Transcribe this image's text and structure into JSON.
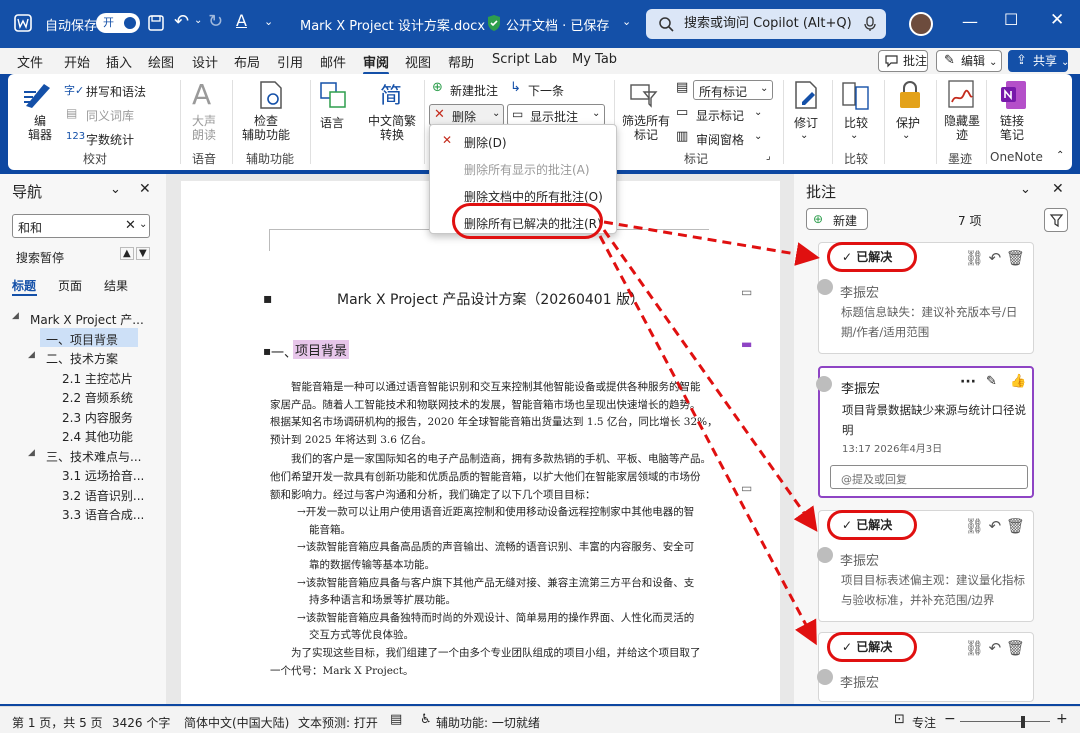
{
  "titlebar": {
    "autosave_label": "自动保存",
    "autosave_state": "开",
    "document_title": "Mark X Project 设计方案.docx",
    "sensitivity": "公开文档 · 已保存",
    "search_placeholder": "搜索或询问 Copilot (Alt+Q)"
  },
  "menu": {
    "tabs": [
      "文件",
      "开始",
      "插入",
      "绘图",
      "设计",
      "布局",
      "引用",
      "邮件",
      "审阅",
      "视图",
      "帮助",
      "Script Lab",
      "My Tab"
    ],
    "active_tab": "审阅",
    "comments_button": "批注",
    "edit_button": "编辑",
    "share_button": "共享"
  },
  "ribbon": {
    "proofing": {
      "editor": "编\n辑器",
      "spelling": "拼写和语法",
      "thesaurus": "同义词库",
      "word_count": "字数统计",
      "group": "校对"
    },
    "speech": {
      "read_aloud": "大声\n朗读",
      "group": "语音"
    },
    "accessibility": {
      "check": "检查\n辅助功能",
      "group": "辅助功能"
    },
    "language": {
      "language": "语言",
      "convert": "中文简繁\n转换"
    },
    "comments": {
      "new": "新建批注",
      "delete": "删除",
      "next": "下一条",
      "show": "显示批注"
    },
    "tracking": {
      "filter_all": "筛选所有\n标记",
      "all_markup": "所有标记",
      "show_markup": "显示标记",
      "review_pane": "审阅窗格",
      "group": "标记"
    },
    "changes": {
      "track": "修订"
    },
    "compare": {
      "compare": "比较",
      "group": "比较"
    },
    "protect": {
      "protect": "保护"
    },
    "ink": {
      "hide_ink": "隐藏墨\n迹",
      "group": "墨迹"
    },
    "onenote": {
      "link": "链接\n笔记",
      "group": "OneNote"
    }
  },
  "delete_menu": {
    "items": [
      {
        "label": "删除(D)",
        "enabled": true
      },
      {
        "label": "删除所有显示的批注(A)",
        "enabled": false
      },
      {
        "label": "删除文档中的所有批注(O)",
        "enabled": true
      },
      {
        "label": "删除所有已解决的批注(R)",
        "enabled": true
      }
    ]
  },
  "navigation": {
    "title": "导航",
    "search_value": "和和",
    "search_paused": "搜索暂停",
    "tabs": [
      "标题",
      "页面",
      "结果"
    ],
    "active_tab": "标题",
    "tree": [
      {
        "label": "Mark X Project 产...",
        "level": 0
      },
      {
        "label": "一、项目背景",
        "level": 1,
        "selected": true
      },
      {
        "label": "二、技术方案",
        "level": 1
      },
      {
        "label": "2.1 主控芯片",
        "level": 2
      },
      {
        "label": "2.2 音频系统",
        "level": 2
      },
      {
        "label": "2.3 内容服务",
        "level": 2
      },
      {
        "label": "2.4 其他功能",
        "level": 2
      },
      {
        "label": "三、技术难点与...",
        "level": 1
      },
      {
        "label": "3.1 远场拾音...",
        "level": 2
      },
      {
        "label": "3.2 语音识别...",
        "level": 2
      },
      {
        "label": "3.3 语音合成...",
        "level": 2
      }
    ]
  },
  "document": {
    "title": "Mark X Project 产品设计方案（20260401 版）",
    "heading_num": "一、",
    "heading": "项目背景",
    "para1": [
      "智能音箱是一种可以通过语音智能识别和交互来控制其他智能设备或提供各种服务的智能",
      "家居产品。随着人工智能技术和物联网技术的发展，智能音箱市场也呈现出快速增长的趋势。",
      "根据某知名市场调研机构的报告，2020 年全球智能音箱出货量达到 1.5 亿台，同比增长 32%，",
      "预计到 2025 年将达到 3.6 亿台。"
    ],
    "para2": [
      "我们的客户是一家国际知名的电子产品制造商，拥有多款热销的手机、平板、电脑等产品。",
      "他们希望开发一款具有创新功能和优质品质的智能音箱，以扩大他们在智能家居领域的市场份",
      "额和影响力。经过与客户沟通和分析，我们确定了以下几个项目目标："
    ],
    "bullets": [
      [
        "→开发一款可以让用户使用语音近距离控制和使用移动设备远程控制家中其他电器的智",
        "能音箱。"
      ],
      [
        "→该款智能音箱应具备高品质的声音输出、流畅的语音识别、丰富的内容服务、安全可",
        "靠的数据传输等基本功能。"
      ],
      [
        "→该款智能音箱应具备与客户旗下其他产品无缝对接、兼容主流第三方平台和设备、支",
        "持多种语言和场景等扩展功能。"
      ],
      [
        "→该款智能音箱应具备独特而时尚的外观设计、简单易用的操作界面、人性化而灵活的",
        "交互方式等优良体验。"
      ]
    ],
    "para3": [
      "为了实现这些目标，我们组建了一个由多个专业团队组成的项目小组，并给这个项目取了",
      "一个代号：Mark X Project。"
    ]
  },
  "comments_pane": {
    "title": "批注",
    "new_button": "新建",
    "count": "7 项",
    "resolved_label": "已解决",
    "cards": [
      {
        "resolved": true,
        "author": "李振宏",
        "text": "标题信息缺失：建议补充版本号/日期/作者/适用范围"
      },
      {
        "resolved": false,
        "author": "李振宏",
        "text": "项目背景数据缺少来源与统计口径说明",
        "time": "13:17 2026年4月3日",
        "reply_placeholder": "@提及或回复"
      },
      {
        "resolved": true,
        "author": "李振宏",
        "text": "项目目标表述偏主观：建议量化指标与验收标准，并补充范围/边界"
      },
      {
        "resolved": true,
        "author": "李振宏",
        "text": ""
      }
    ]
  },
  "statusbar": {
    "page": "第 1 页，共 5 页",
    "words": "3426 个字",
    "language": "简体中文(中国大陆)",
    "prediction": "文本预测: 打开",
    "accessibility": "辅助功能: 一切就绪",
    "focus": "专注"
  },
  "colors": {
    "titlebar": "#1450a8",
    "accent": "#1450a8",
    "annotation": "#e01010",
    "active_comment_border": "#8e44c4"
  },
  "zoom": {
    "level": 0.68
  }
}
